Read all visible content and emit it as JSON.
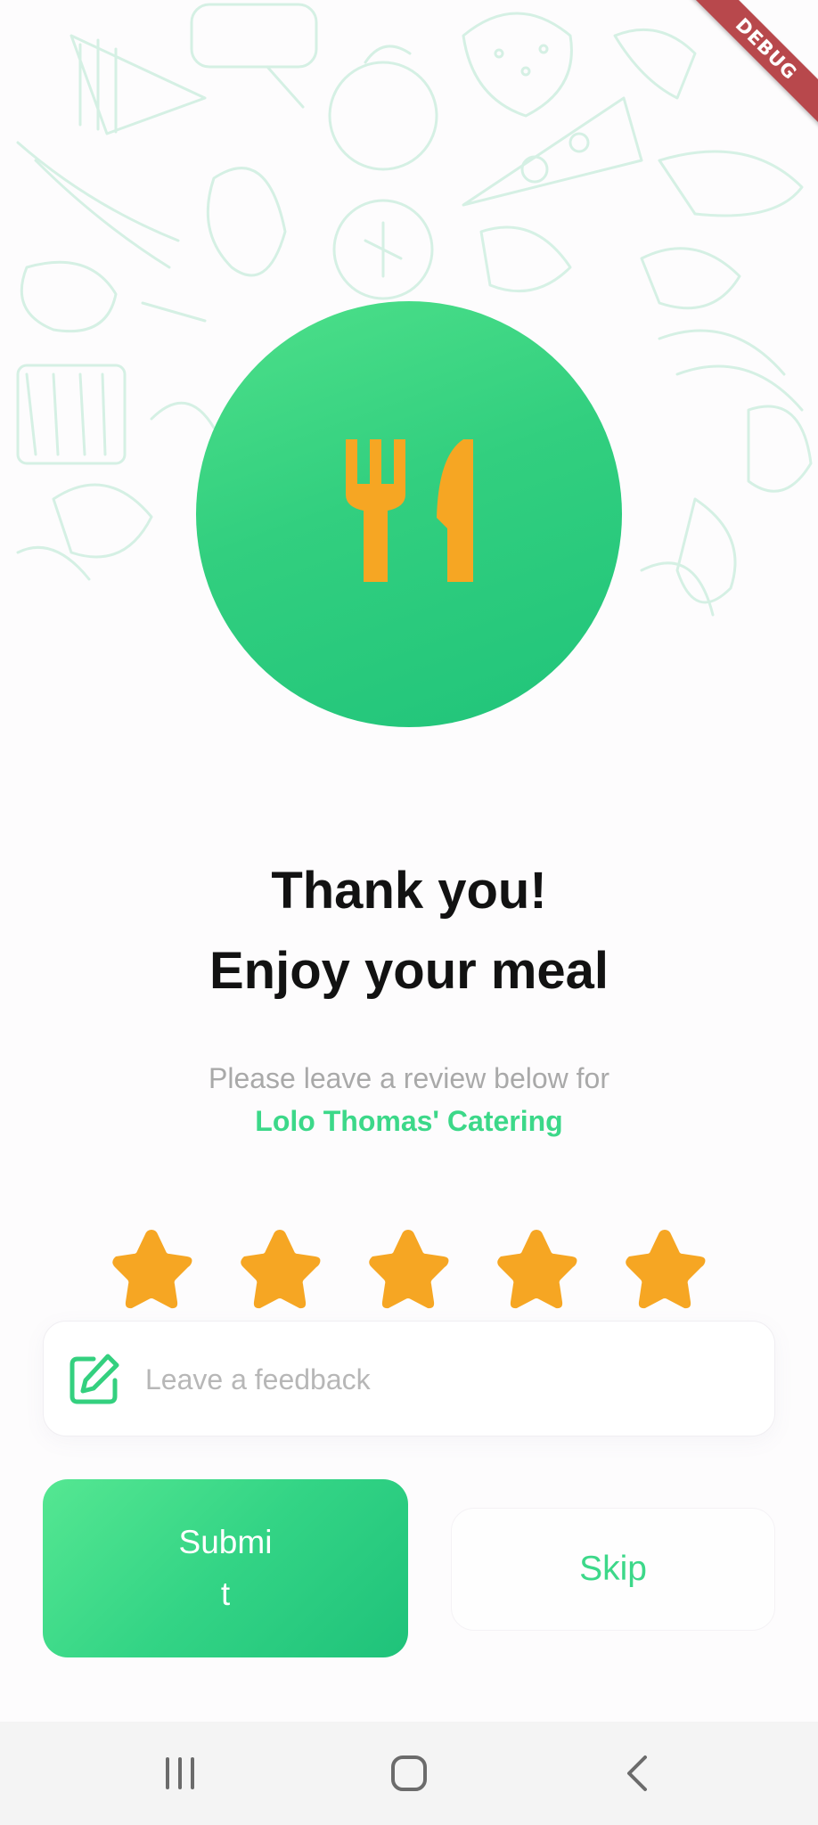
{
  "debug_banner": {
    "label": "DEBUG"
  },
  "hero": {
    "icon": "fork-knife-icon",
    "circle_color": "#34d07f",
    "icon_color": "#f6a623"
  },
  "thanks": {
    "line1": "Thank you!",
    "line2": "Enjoy your meal"
  },
  "review_prompt": {
    "text": "Please leave a review below for",
    "vendor": "Lolo Thomas' Catering"
  },
  "rating": {
    "value": 5,
    "max": 5,
    "star_color": "#f6a623"
  },
  "feedback": {
    "placeholder": "Leave a feedback",
    "value": "",
    "icon": "edit-icon"
  },
  "actions": {
    "submit_line1": "Submi",
    "submit_line2": "t",
    "skip": "Skip"
  },
  "system_nav": {
    "recents": "recents-icon",
    "home": "home-icon",
    "back": "back-icon"
  },
  "colors": {
    "accent": "#3cd889",
    "star": "#f6a623",
    "background": "#fdfcfd"
  }
}
